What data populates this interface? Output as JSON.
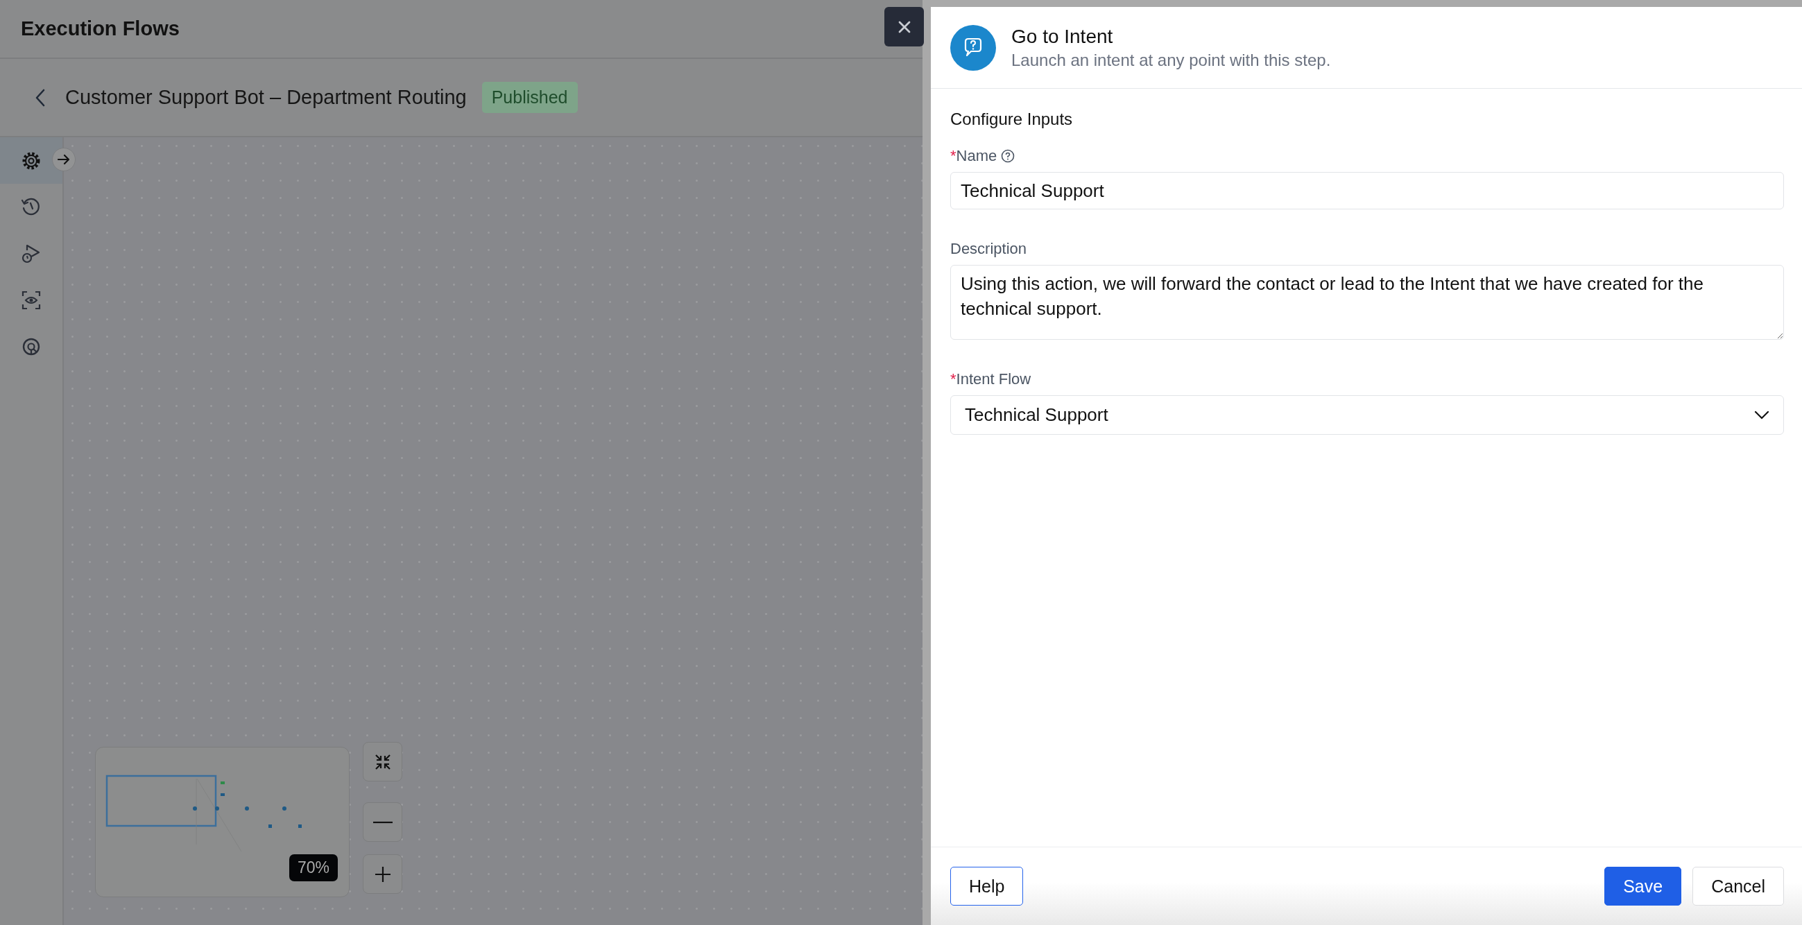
{
  "app": {
    "title": "Execution Flows"
  },
  "flow": {
    "title": "Customer Support Bot – Department Routing",
    "status": "Published"
  },
  "sidebar": {
    "items": [
      {
        "kind": "settings",
        "selected": true
      },
      {
        "kind": "history",
        "selected": false
      },
      {
        "kind": "test-run",
        "selected": false
      },
      {
        "kind": "preview",
        "selected": false
      },
      {
        "kind": "analytics",
        "selected": false
      }
    ]
  },
  "canvas": {
    "zoom": "70%"
  },
  "panel": {
    "title": "Go to Intent",
    "subtitle": "Launch an intent at any point with this step.",
    "section": "Configure Inputs",
    "fields": [
      {
        "kind": "text",
        "label": "Name",
        "required_mark": "*",
        "help": true,
        "value": "Technical Support"
      },
      {
        "kind": "textarea",
        "label": "Description",
        "help": false,
        "value": "Using this action, we will forward the contact or lead to the Intent that we have created for the technical support."
      },
      {
        "kind": "select",
        "label": "Intent Flow",
        "required_mark": "*",
        "help": false,
        "value": "Technical Support"
      }
    ],
    "footer": {
      "help": "Help",
      "save": "Save",
      "cancel": "Cancel"
    }
  }
}
